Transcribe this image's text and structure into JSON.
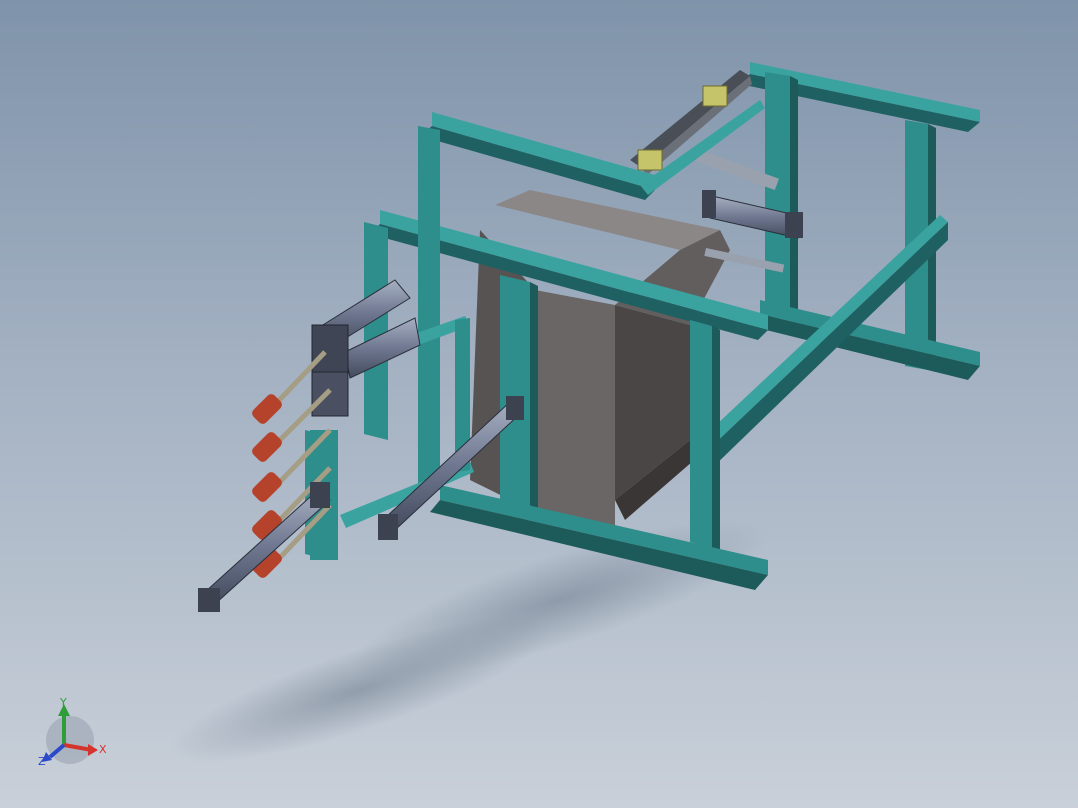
{
  "triad": {
    "x_label": "X",
    "y_label": "Y",
    "z_label": "Z",
    "x_color": "#d4342b",
    "y_color": "#2f9e3a",
    "z_color": "#2b49c8"
  },
  "colors": {
    "frame": "#2e8e8c",
    "frame_dark": "#1e5d5e",
    "frame_light": "#49b0ad",
    "block_front": "#5e5a5a",
    "block_top": "#8a8686",
    "block_dark": "#3c3838",
    "cylinder": "#7e889c",
    "rubber": "#b0432d",
    "sensor": "#c8c86a"
  }
}
